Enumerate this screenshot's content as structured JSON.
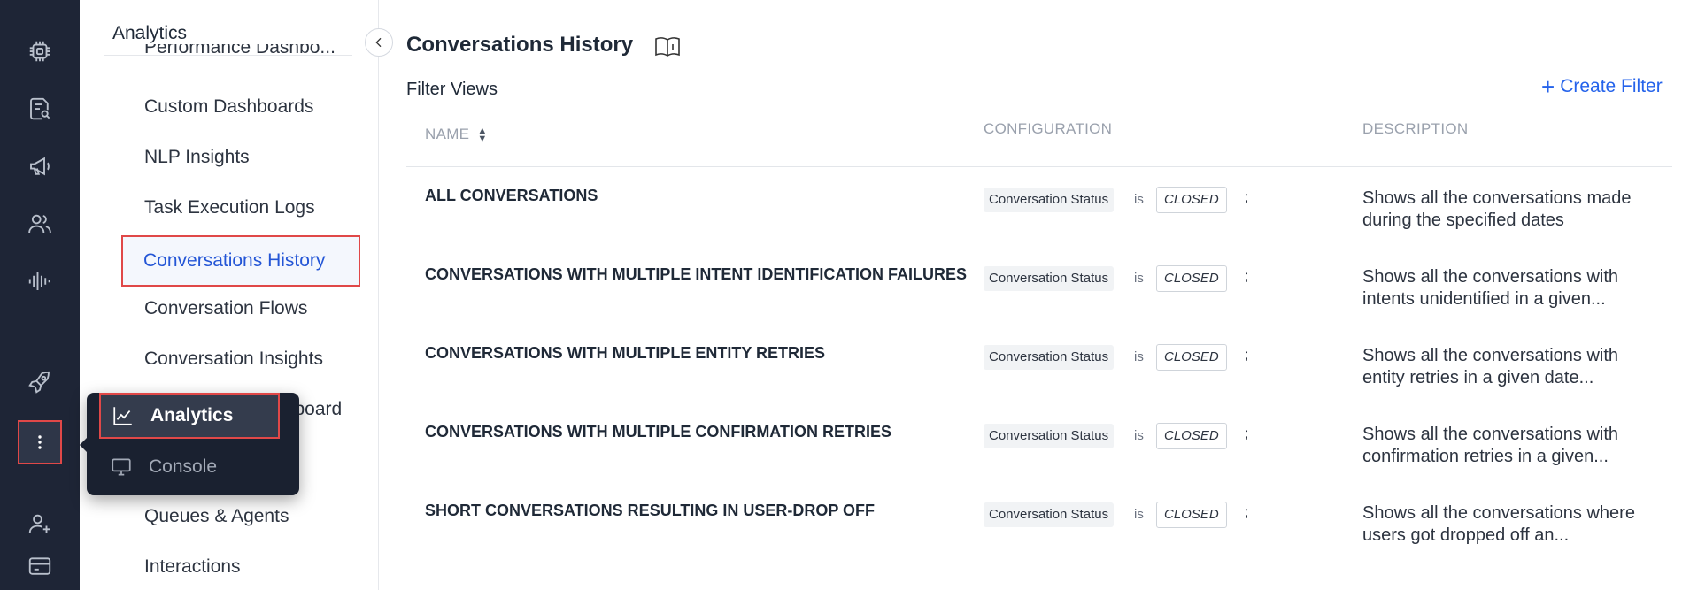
{
  "rail": {
    "icons": [
      "chip-icon",
      "document-search-icon",
      "megaphone-icon",
      "users-icon",
      "waveform-icon",
      "rocket-icon",
      "more-vertical-icon",
      "add-user-icon",
      "card-icon"
    ]
  },
  "subnav": {
    "title": "Analytics",
    "partial_item": "Performance Dashbo...",
    "items": [
      "Custom Dashboards",
      "NLP Insights",
      "Task Execution Logs",
      "Conversations History",
      "Conversation Flows",
      "Conversation Insights",
      "...board",
      "Queues & Agents",
      "Interactions"
    ],
    "active_item": "Conversations History"
  },
  "popover": {
    "items": [
      {
        "label": "Analytics",
        "icon": "line-chart-icon",
        "active": true
      },
      {
        "label": "Console",
        "icon": "monitor-icon",
        "active": false
      }
    ]
  },
  "main": {
    "title": "Conversations History",
    "section_label": "Filter Views",
    "create_filter_label": "Create Filter",
    "columns": {
      "name": "NAME",
      "configuration": "CONFIGURATION",
      "description": "DESCRIPTION"
    },
    "rows": [
      {
        "name": "ALL CONVERSATIONS",
        "config_field": "Conversation Status",
        "config_op": "is",
        "config_value": "CLOSED",
        "config_sep": ";",
        "description": "Shows all the conversations made during the specified dates"
      },
      {
        "name": "CONVERSATIONS WITH MULTIPLE INTENT IDENTIFICATION FAILURES",
        "config_field": "Conversation Status",
        "config_op": "is",
        "config_value": "CLOSED",
        "config_sep": ";",
        "description": "Shows all the conversations with intents unidentified in a given..."
      },
      {
        "name": "CONVERSATIONS WITH MULTIPLE ENTITY RETRIES",
        "config_field": "Conversation Status",
        "config_op": "is",
        "config_value": "CLOSED",
        "config_sep": ";",
        "description": "Shows all the conversations with entity retries in a given date..."
      },
      {
        "name": "CONVERSATIONS WITH MULTIPLE CONFIRMATION RETRIES",
        "config_field": "Conversation Status",
        "config_op": "is",
        "config_value": "CLOSED",
        "config_sep": ";",
        "description": "Shows all the conversations with confirmation retries in a given..."
      },
      {
        "name": "SHORT CONVERSATIONS RESULTING IN USER-DROP OFF",
        "config_field": "Conversation Status",
        "config_op": "is",
        "config_value": "CLOSED",
        "config_sep": ";",
        "description": "Shows all the conversations where users got dropped off an..."
      }
    ]
  },
  "colors": {
    "rail_bg": "#1e2536",
    "accent_blue": "#2563eb",
    "highlight_red": "#e04848"
  }
}
